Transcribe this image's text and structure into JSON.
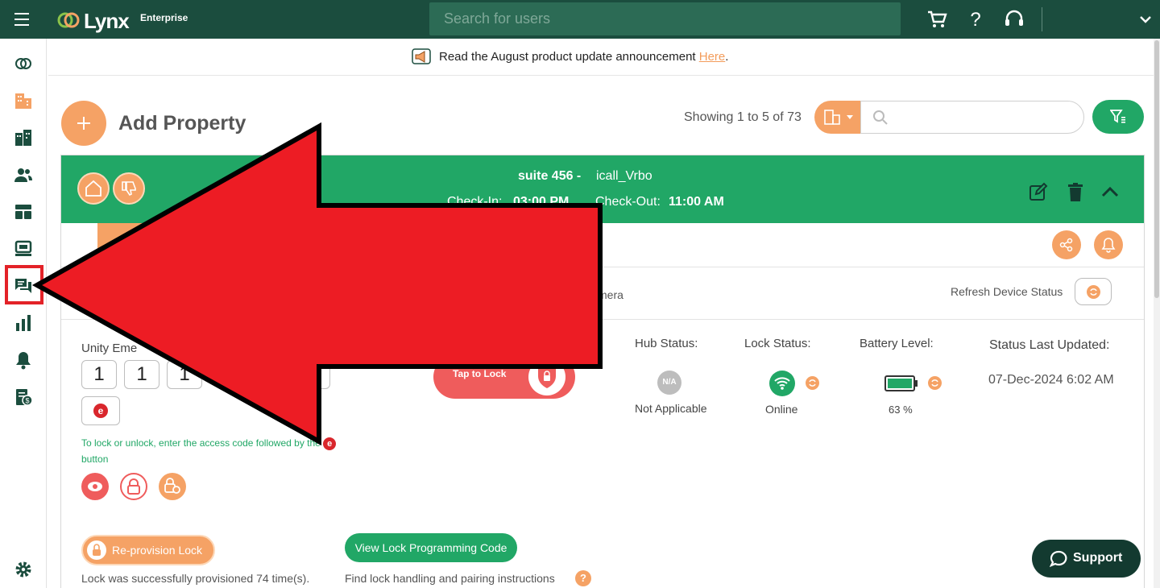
{
  "topbar": {
    "brand": "Lynx",
    "brand_sub": "Enterprise",
    "search_placeholder": "Search for users",
    "icons": [
      "menu-icon",
      "cart-icon",
      "help-icon",
      "support-headset-icon",
      "chevron-down-icon"
    ]
  },
  "sidebar": {
    "items": [
      "logo-icon",
      "properties-icon",
      "buildings-icon",
      "users-icon",
      "dashboard-icon",
      "devices-icon",
      "messages-icon",
      "reports-icon",
      "notifications-icon",
      "billing-icon",
      "settings-icon"
    ],
    "highlighted": "messages-icon"
  },
  "announcement": {
    "text": "Read the August product update announcement ",
    "link": "Here",
    "suffix": "."
  },
  "toolbar": {
    "add_label": "Add Property",
    "showing": "Showing 1 to 5 of 73"
  },
  "property": {
    "unit": "suite 456 -",
    "name": "icall_Vrbo",
    "checkin_label": "Check-In:",
    "checkin": "03:00 PM",
    "checkout_label": "Check-Out:",
    "checkout": "11:00 AM"
  },
  "device": {
    "tab_camera": "mera",
    "refresh_label": "Refresh Device Status",
    "unity_label": "Unity Eme",
    "code": [
      "1",
      "1",
      "1"
    ],
    "e_label": "e",
    "hint": "To lock or unlock, enter the access code followed by the",
    "hint_end": "button",
    "tap_lock": "Tap to Lock",
    "hub_label": "Hub Status:",
    "hub_badge": "N/A",
    "hub_value": "Not Applicable",
    "lock_label": "Lock Status:",
    "lock_value": "Online",
    "battery_label": "Battery Level:",
    "battery_value": "63 %",
    "battery_percent": 63,
    "updated_label": "Status Last Updated:",
    "updated_value": "07-Dec-2024 6:02 AM",
    "reprovision": "Re-provision Lock",
    "provision_note": "Lock was successfully provisioned 74 time(s).",
    "view_code": "View Lock Programming Code",
    "find_note": "Find lock handling and pairing instructions",
    "help_mark": "?"
  },
  "support": {
    "label": "Support"
  },
  "colors": {
    "green": "#21a766",
    "dark": "#1b4d3e",
    "orange": "#f5a265",
    "red": "#e32228"
  }
}
